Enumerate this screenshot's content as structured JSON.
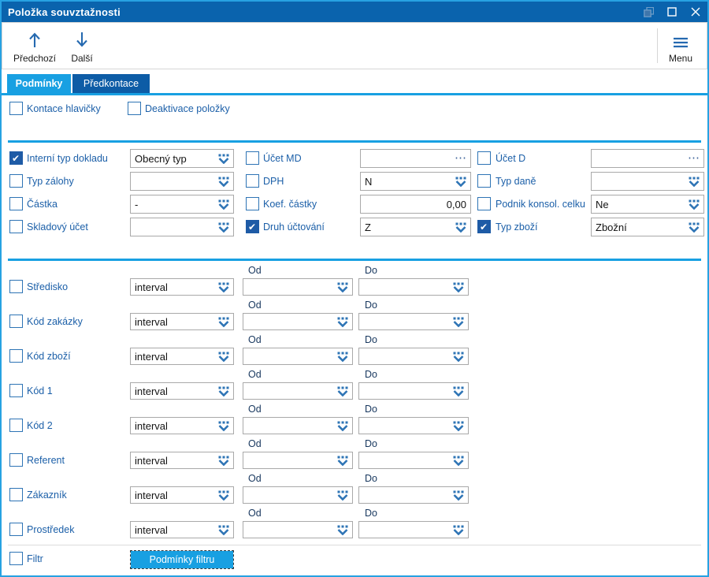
{
  "window": {
    "title": "Položka souvztažnosti"
  },
  "titlebar": {
    "restore_icon": "overlapping-squares",
    "maximize_icon": "square-outline",
    "close_icon": "x-cross"
  },
  "toolbar": {
    "prev_label": "Předchozí",
    "next_label": "Další",
    "menu_label": "Menu",
    "prev_icon": "arrow-up",
    "next_icon": "arrow-down",
    "menu_icon": "hamburger"
  },
  "tabs": [
    {
      "label": "Podmínky",
      "active": true
    },
    {
      "label": "Předkontace",
      "active": false
    }
  ],
  "header_checks": [
    {
      "label": "Kontace hlavičky",
      "checked": false
    },
    {
      "label": "Deaktivace položky",
      "checked": false
    }
  ],
  "conditions": {
    "col1": [
      {
        "label": "Interní typ dokladu",
        "checked": true,
        "value": "Obecný typ",
        "control": "dropdown"
      },
      {
        "label": "Typ zálohy",
        "checked": false,
        "value": "",
        "control": "dropdown"
      },
      {
        "label": "Částka",
        "checked": false,
        "value": "-",
        "control": "dropdown"
      },
      {
        "label": "Skladový účet",
        "checked": false,
        "value": "",
        "control": "dropdown"
      }
    ],
    "col2": [
      {
        "label": "Účet MD",
        "checked": false,
        "value": "",
        "control": "lookup"
      },
      {
        "label": "DPH",
        "checked": false,
        "value": "N",
        "control": "dropdown"
      },
      {
        "label": "Koef. částky",
        "checked": false,
        "value": "0,00",
        "control": "number"
      },
      {
        "label": "Druh účtování",
        "checked": true,
        "value": "Z",
        "control": "dropdown"
      }
    ],
    "col3": [
      {
        "label": "Účet D",
        "checked": false,
        "value": "",
        "control": "lookup"
      },
      {
        "label": "Typ daně",
        "checked": false,
        "value": "",
        "control": "dropdown"
      },
      {
        "label": "Podnik konsol. celku",
        "checked": false,
        "value": "Ne",
        "control": "dropdown"
      },
      {
        "label": "Typ zboží",
        "checked": true,
        "value": "Zbožní",
        "control": "dropdown"
      }
    ]
  },
  "intervals": {
    "od_label": "Od",
    "do_label": "Do",
    "interval_value": "interval",
    "od_value": "",
    "do_value": "",
    "rows": [
      {
        "label": "Středisko"
      },
      {
        "label": "Kód zakázky"
      },
      {
        "label": "Kód zboží"
      },
      {
        "label": "Kód 1"
      },
      {
        "label": "Kód 2"
      },
      {
        "label": "Referent"
      },
      {
        "label": "Zákazník"
      },
      {
        "label": "Prostředek"
      }
    ]
  },
  "filter": {
    "label": "Filtr",
    "checked": false,
    "button_label": "Podmínky filtru"
  },
  "icons": {
    "dropdown": "dotted-chevron-down",
    "ellipsis": "⋯",
    "check": "✔"
  },
  "colors": {
    "title_bar": "#0a63ad",
    "accent_cyan": "#18a0e2",
    "tab_inactive": "#0d5ca6",
    "window_border": "#27a2e2",
    "checkbox_border": "#2e74b5",
    "checkbox_checked": "#1e5ba6",
    "label_blue": "#1b5fa8",
    "range_label_navy": "#17375e",
    "field_border": "#a9a9a9",
    "toolbar_icon_blue": "#2569b0"
  }
}
